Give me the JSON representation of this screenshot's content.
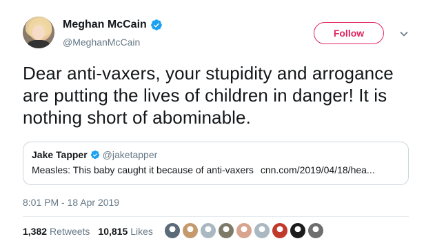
{
  "author": {
    "display_name": "Meghan McCain",
    "handle": "@MeghanMcCain",
    "verified": true
  },
  "follow_label": "Follow",
  "tweet_text": "Dear anti-vaxers, your stupidity and arrogance are putting the lives of children in danger! It is nothing short of abominable.",
  "quoted_tweet": {
    "display_name": "Jake Tapper",
    "handle": "@jaketapper",
    "verified": true,
    "text": "Measles: This baby caught it because of anti-vaxers",
    "link": "cnn.com/2019/04/18/hea..."
  },
  "timestamp": "8:01 PM - 18 Apr 2019",
  "stats": {
    "retweets_count": "1,382",
    "retweets_label": "Retweets",
    "likes_count": "10,815",
    "likes_label": "Likes"
  },
  "liker_avatars": [
    {
      "name": "liker-avatar",
      "color": "#5b6b7a"
    },
    {
      "name": "liker-avatar",
      "color": "#c49a6c"
    },
    {
      "name": "liker-avatar",
      "color": "#aab8c2"
    },
    {
      "name": "liker-avatar",
      "color": "#7d7a6a"
    },
    {
      "name": "liker-avatar",
      "color": "#d8a48f"
    },
    {
      "name": "liker-avatar",
      "color": "#aab8c2"
    },
    {
      "name": "liker-avatar",
      "color": "#c0392b"
    },
    {
      "name": "liker-avatar",
      "color": "#1c1c1c"
    },
    {
      "name": "liker-avatar",
      "color": "#6e6e6e"
    }
  ],
  "colors": {
    "accent": "#e0245e",
    "verified_blue": "#1da1f2",
    "secondary_text": "#657786"
  }
}
